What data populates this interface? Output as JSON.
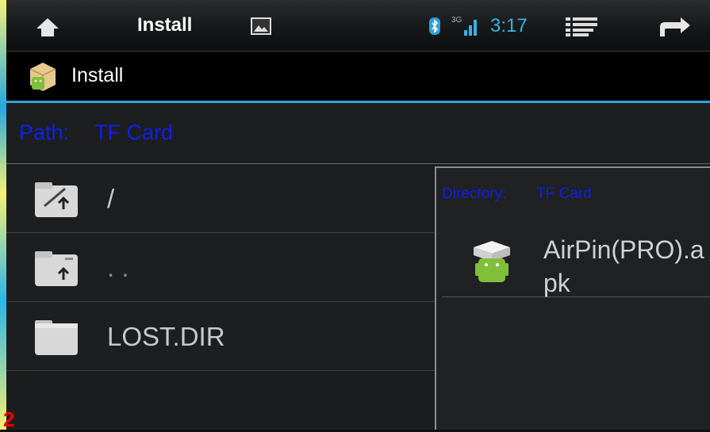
{
  "statusbar": {
    "title": "Install",
    "time": "3:17",
    "network": "3G"
  },
  "appbar": {
    "title": "Install"
  },
  "path": {
    "label": "Path:",
    "value": "TF Card"
  },
  "list": [
    {
      "label": "/"
    },
    {
      "label": ". ."
    },
    {
      "label": "LOST.DIR"
    }
  ],
  "panel": {
    "label": "Directory:",
    "value": "TF Card",
    "file": "AirPin(PRO).apk"
  },
  "corner_mark": "2",
  "colors": {
    "accent": "#2fa3d6",
    "time": "#37b2e8",
    "path_text": "#1020e8"
  },
  "icons": [
    "home-icon",
    "gallery-icon",
    "bluetooth-icon",
    "signal-icon",
    "menu-icon",
    "back-icon",
    "android-package-icon",
    "folder-up-icon",
    "folder-icon"
  ]
}
